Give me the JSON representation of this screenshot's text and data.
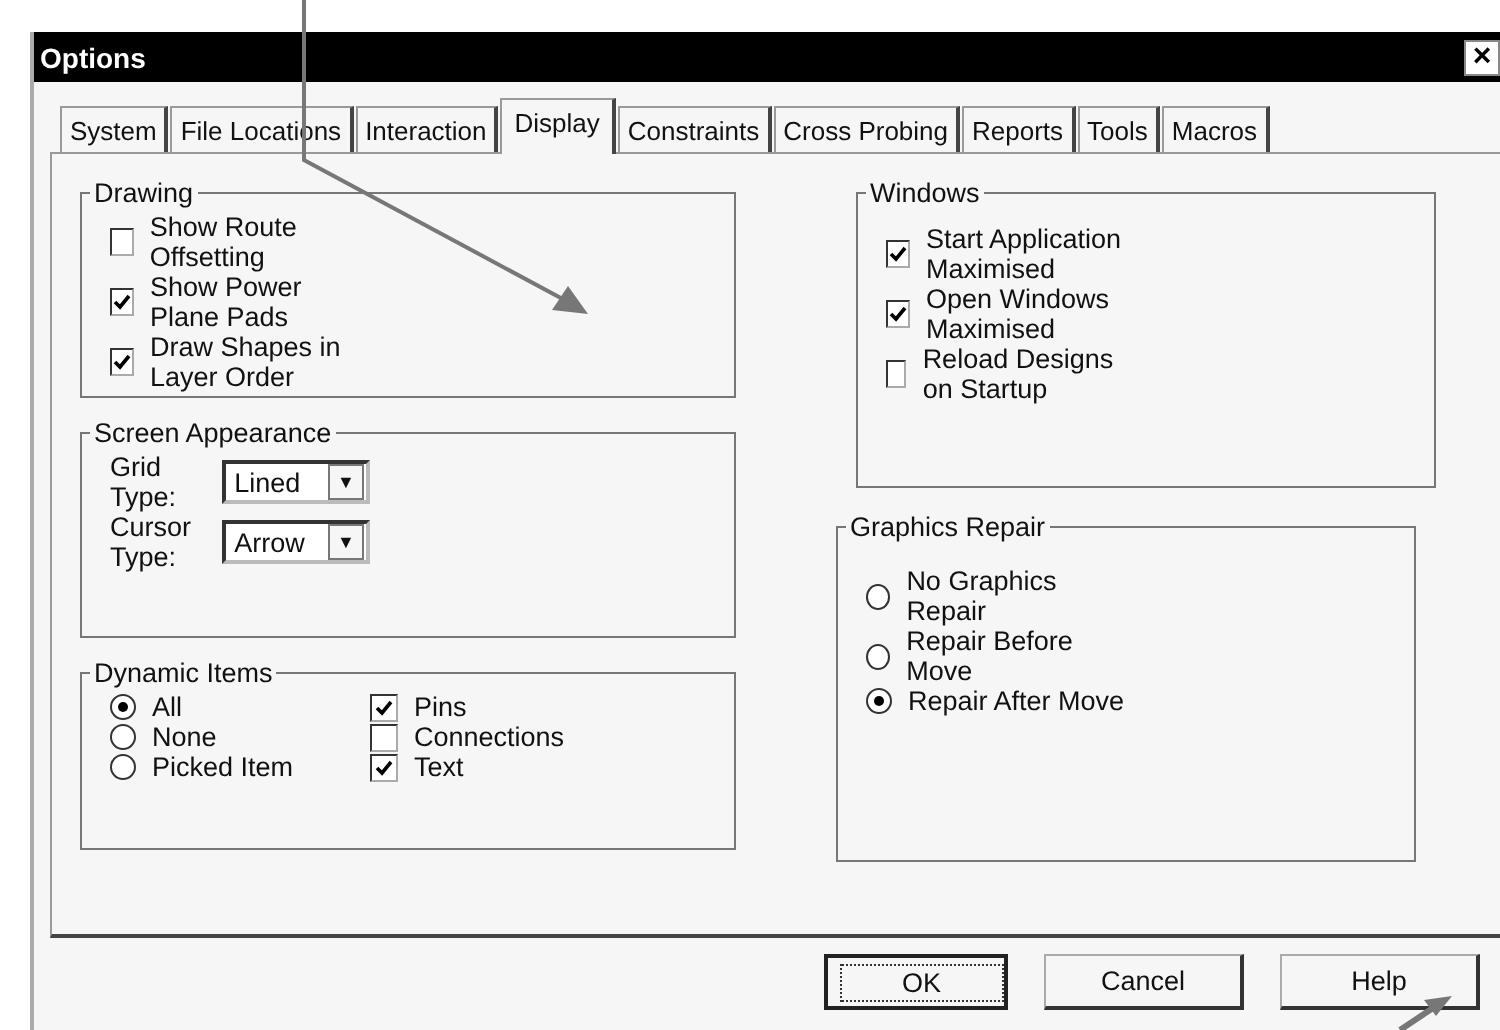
{
  "window": {
    "title": "Options",
    "close": "×"
  },
  "tabs": [
    {
      "label": "System",
      "selected": false
    },
    {
      "label": "File Locations",
      "selected": false
    },
    {
      "label": "Interaction",
      "selected": false
    },
    {
      "label": "Display",
      "selected": true
    },
    {
      "label": "Constraints",
      "selected": false
    },
    {
      "label": "Cross Probing",
      "selected": false
    },
    {
      "label": "Reports",
      "selected": false
    },
    {
      "label": "Tools",
      "selected": false
    },
    {
      "label": "Macros",
      "selected": false
    }
  ],
  "left_groups": [
    {
      "title": "Drawing",
      "rows": [
        [
          {
            "kind": "checkbox",
            "label": "Show Route Offsetting",
            "checked": false
          }
        ],
        [
          {
            "kind": "checkbox",
            "label": "Show Power Plane Pads",
            "checked": true
          }
        ],
        [
          {
            "kind": "checkbox",
            "label": "Draw Shapes in Layer Order",
            "checked": true
          }
        ]
      ]
    },
    {
      "title": "Screen Appearance",
      "rows": [
        [
          {
            "kind": "select",
            "label": "Grid Type:",
            "value": "Lined",
            "arrow": "▼"
          }
        ],
        [
          {
            "kind": "select",
            "label": "Cursor Type:",
            "value": "Arrow",
            "arrow": "▼"
          }
        ]
      ]
    },
    {
      "title": "Dynamic Items",
      "rows": [
        [
          {
            "kind": "radio",
            "label": "All",
            "selected": true
          },
          {
            "kind": "checkbox",
            "label": "Pins",
            "checked": true
          }
        ],
        [
          {
            "kind": "radio",
            "label": "None",
            "selected": false
          },
          {
            "kind": "checkbox",
            "label": "Connections",
            "checked": false
          }
        ],
        [
          {
            "kind": "radio",
            "label": "Picked Item",
            "selected": false
          },
          {
            "kind": "checkbox",
            "label": "Text",
            "checked": true
          }
        ]
      ]
    }
  ],
  "right_groups": [
    {
      "title": "Windows",
      "rows": [
        [
          {
            "kind": "checkbox",
            "label": "Start Application Maximised",
            "checked": true
          }
        ],
        [
          {
            "kind": "checkbox",
            "label": "Open Windows Maximised",
            "checked": true
          }
        ],
        [
          {
            "kind": "checkbox",
            "label": "Reload Designs on Startup",
            "checked": false
          }
        ]
      ]
    },
    {
      "title": "Graphics Repair",
      "rows": [
        [
          {
            "kind": "radio",
            "label": "No Graphics Repair",
            "selected": false
          }
        ],
        [
          {
            "kind": "radio",
            "label": "Repair Before Move",
            "selected": false
          }
        ],
        [
          {
            "kind": "radio",
            "label": "Repair After Move",
            "selected": true
          }
        ]
      ]
    }
  ],
  "buttons": [
    {
      "label": "OK",
      "default": true
    },
    {
      "label": "Cancel",
      "default": false
    },
    {
      "label": "Help",
      "default": false
    }
  ]
}
